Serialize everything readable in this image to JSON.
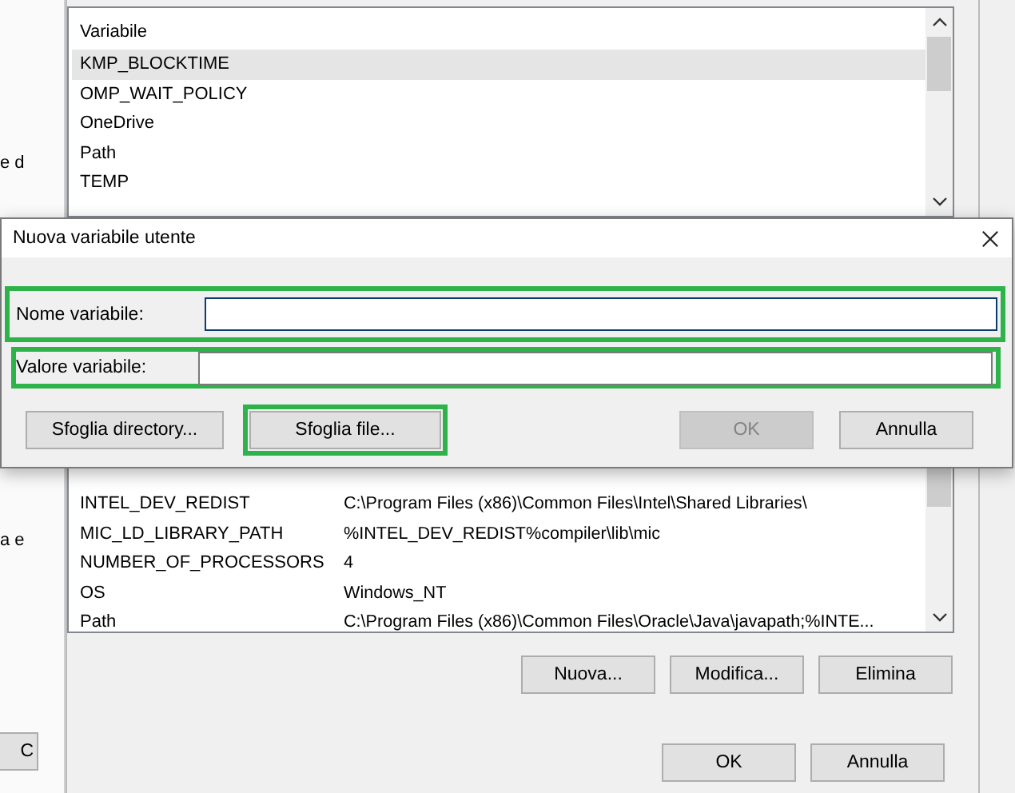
{
  "behind_window": {
    "fragments": [
      "e d",
      "a e"
    ],
    "button": "C"
  },
  "environment_dialog": {
    "user_variables": {
      "column": "Variabile",
      "rows": [
        {
          "name": "KMP_BLOCKTIME",
          "selected": true
        },
        {
          "name": "OMP_WAIT_POLICY",
          "selected": false
        },
        {
          "name": "OneDrive",
          "selected": false
        },
        {
          "name": "Path",
          "selected": false
        },
        {
          "name": "TEMP",
          "selected": false
        }
      ]
    },
    "system_variables": {
      "rows": [
        {
          "name": "INTEL_DEV_REDIST",
          "value": "C:\\Program Files (x86)\\Common Files\\Intel\\Shared Libraries\\"
        },
        {
          "name": "MIC_LD_LIBRARY_PATH",
          "value": "%INTEL_DEV_REDIST%compiler\\lib\\mic"
        },
        {
          "name": "NUMBER_OF_PROCESSORS",
          "value": "4"
        },
        {
          "name": "OS",
          "value": "Windows_NT"
        },
        {
          "name": "Path",
          "value": "C:\\Program Files (x86)\\Common Files\\Oracle\\Java\\javapath;%INTE..."
        }
      ]
    },
    "list_buttons": [
      "Nuova...",
      "Modifica...",
      "Elimina"
    ],
    "dialog_buttons": [
      "OK",
      "Annulla"
    ]
  },
  "new_variable_dialog": {
    "title": "Nuova variabile utente",
    "fields": [
      {
        "label": "Nome variabile:",
        "highlighted": true
      },
      {
        "label": "Valore variabile:",
        "highlighted": true
      }
    ],
    "buttons": [
      {
        "label": "Sfoglia directory...",
        "disabled": false,
        "highlighted": false
      },
      {
        "label": "Sfoglia file...",
        "disabled": false,
        "highlighted": true
      },
      {
        "label": "OK",
        "disabled": true,
        "highlighted": false
      },
      {
        "label": "Annulla",
        "disabled": false,
        "highlighted": false
      }
    ]
  }
}
